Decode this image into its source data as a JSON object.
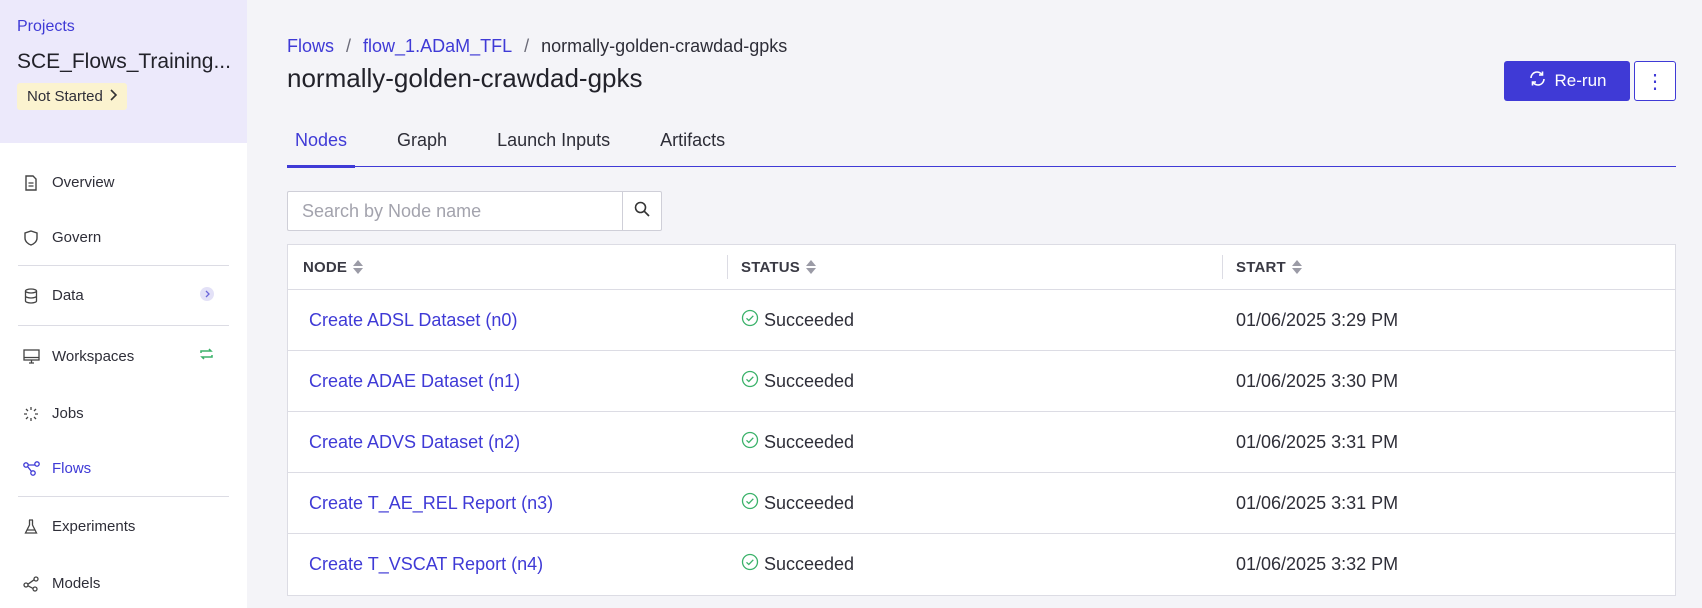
{
  "sidebar": {
    "projects_link": "Projects",
    "project_name": "SCE_Flows_Training...",
    "project_status": "Not Started",
    "items": [
      {
        "label": "Overview",
        "icon": "document-icon"
      },
      {
        "label": "Govern",
        "icon": "shield-icon"
      },
      {
        "label": "Data",
        "icon": "database-icon"
      },
      {
        "label": "Workspaces",
        "icon": "monitor-icon"
      },
      {
        "label": "Jobs",
        "icon": "spinner-icon"
      },
      {
        "label": "Flows",
        "icon": "flow-icon"
      },
      {
        "label": "Experiments",
        "icon": "flask-icon"
      },
      {
        "label": "Models",
        "icon": "model-icon"
      }
    ]
  },
  "breadcrumb": {
    "root": "Flows",
    "parent": "flow_1.ADaM_TFL",
    "current": "normally-golden-crawdad-gpks",
    "separator": "/"
  },
  "header": {
    "title": "normally-golden-crawdad-gpks",
    "rerun_label": "Re-run",
    "more_label": "⋮"
  },
  "tabs": [
    {
      "label": "Nodes",
      "active": true
    },
    {
      "label": "Graph",
      "active": false
    },
    {
      "label": "Launch Inputs",
      "active": false
    },
    {
      "label": "Artifacts",
      "active": false
    }
  ],
  "search": {
    "placeholder": "Search by Node name"
  },
  "table": {
    "columns": [
      "NODE",
      "STATUS",
      "START"
    ],
    "rows": [
      {
        "node": "Create ADSL Dataset (n0)",
        "status": "Succeeded",
        "start": "01/06/2025 3:29 PM"
      },
      {
        "node": "Create ADAE Dataset (n1)",
        "status": "Succeeded",
        "start": "01/06/2025 3:30 PM"
      },
      {
        "node": "Create ADVS Dataset (n2)",
        "status": "Succeeded",
        "start": "01/06/2025 3:31 PM"
      },
      {
        "node": "Create T_AE_REL Report (n3)",
        "status": "Succeeded",
        "start": "01/06/2025 3:31 PM"
      },
      {
        "node": "Create T_VSCAT Report (n4)",
        "status": "Succeeded",
        "start": "01/06/2025 3:32 PM"
      }
    ]
  },
  "colors": {
    "accent": "#3f3ad6",
    "success": "#3bb26a",
    "status_pill_bg": "#fbf3cf",
    "sidebar_head_bg": "#ece9fb"
  }
}
